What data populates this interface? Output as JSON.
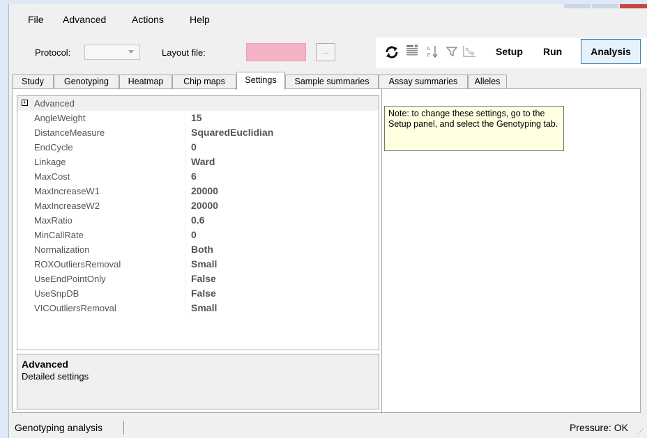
{
  "menu": {
    "items": [
      "File",
      "Advanced",
      "Actions",
      "Help"
    ]
  },
  "toolbar": {
    "protocol_label": "Protocol:",
    "protocol_value": "",
    "layout_label": "Layout file:",
    "browse_label": "...",
    "setup_label": "Setup",
    "run_label": "Run",
    "analysis_label": "Analysis"
  },
  "tabs": [
    "Study",
    "Genotyping",
    "Heatmap",
    "Chip maps",
    "Settings",
    "Sample summaries",
    "Assay summaries",
    "Alleles"
  ],
  "active_tab": "Settings",
  "grid": {
    "category": "Advanced",
    "rows": [
      {
        "name": "AngleWeight",
        "value": "15"
      },
      {
        "name": "DistanceMeasure",
        "value": "SquaredEuclidian"
      },
      {
        "name": "EndCycle",
        "value": "0"
      },
      {
        "name": "Linkage",
        "value": "Ward"
      },
      {
        "name": "MaxCost",
        "value": "6"
      },
      {
        "name": "MaxIncreaseW1",
        "value": "20000"
      },
      {
        "name": "MaxIncreaseW2",
        "value": "20000"
      },
      {
        "name": "MaxRatio",
        "value": "0.6"
      },
      {
        "name": "MinCallRate",
        "value": "0"
      },
      {
        "name": "Normalization",
        "value": "Both"
      },
      {
        "name": "ROXOutliersRemoval",
        "value": "Small"
      },
      {
        "name": "UseEndPointOnly",
        "value": "False"
      },
      {
        "name": "UseSnpDB",
        "value": "False"
      },
      {
        "name": "VICOutliersRemoval",
        "value": "Small"
      }
    ]
  },
  "help": {
    "title": "Advanced",
    "description": "Detailed settings"
  },
  "note": {
    "text": "Note: to change these settings, go to the Setup panel, and select the Genotyping tab."
  },
  "status": {
    "left": "Genotyping analysis",
    "right": "Pressure: OK"
  },
  "colors": {
    "layout_file_box": "#f5b2c5",
    "note_bg": "#ffffe1",
    "analysis_border": "#3c7fb1"
  }
}
